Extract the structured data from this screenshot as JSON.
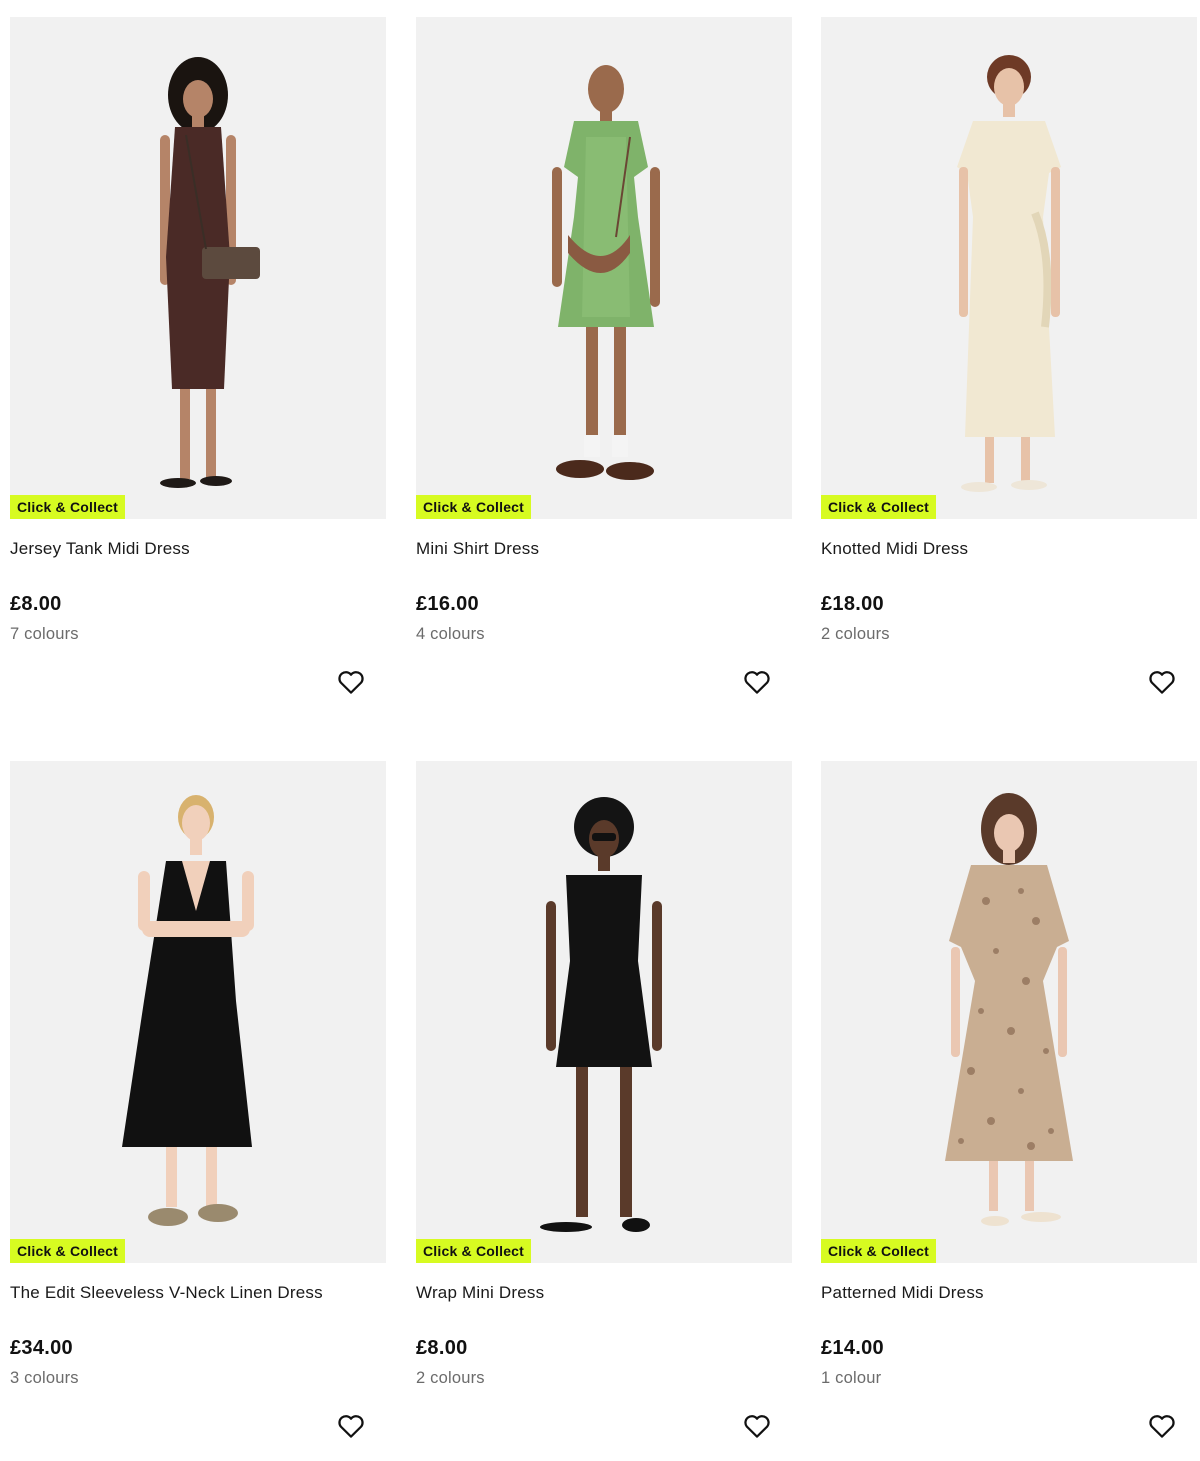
{
  "products": [
    {
      "badge": "Click & Collect",
      "name": "Jersey Tank Midi Dress",
      "price": "£8.00",
      "colours": "7 colours",
      "image": {
        "dress_color": "#4a2a26",
        "style": "tank-midi"
      }
    },
    {
      "badge": "Click & Collect",
      "name": "Mini Shirt Dress",
      "price": "£16.00",
      "colours": "4 colours",
      "image": {
        "dress_color": "#7fb36a",
        "style": "mini-shirt"
      }
    },
    {
      "badge": "Click & Collect",
      "name": "Knotted Midi Dress",
      "price": "£18.00",
      "colours": "2 colours",
      "image": {
        "dress_color": "#f1e8d2",
        "style": "knotted-midi"
      }
    },
    {
      "badge": "Click & Collect",
      "name": "The Edit Sleeveless V-Neck Linen Dress",
      "price": "£34.00",
      "colours": "3 colours",
      "image": {
        "dress_color": "#111111",
        "style": "vneck-linen"
      }
    },
    {
      "badge": "Click & Collect",
      "name": "Wrap Mini Dress",
      "price": "£8.00",
      "colours": "2 colours",
      "image": {
        "dress_color": "#121212",
        "style": "wrap-mini"
      }
    },
    {
      "badge": "Click & Collect",
      "name": "Patterned Midi Dress",
      "price": "£14.00",
      "colours": "1 colour",
      "image": {
        "dress_color": "#c9ae92",
        "style": "patterned-midi"
      }
    }
  ],
  "icons": {
    "wishlist": "heart-outline-icon"
  },
  "colors": {
    "badge_bg": "#d7fb21",
    "image_bg": "#f1f1f1",
    "muted_text": "#6b6b6b"
  }
}
